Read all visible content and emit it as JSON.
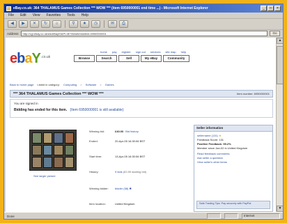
{
  "window": {
    "title": "eBay.co.uk: 364 THALAMUS Games Collection *** WOW *** (item 6950000001 end time ...) - Microsoft Internet Explorer",
    "controls": [
      "_",
      "□",
      "×"
    ]
  },
  "menu": [
    "File",
    "Edit",
    "View",
    "Favorites",
    "Tools",
    "Help"
  ],
  "toolbar": {
    "buttons": [
      {
        "name": "back",
        "glyph": "◀"
      },
      {
        "name": "forward",
        "glyph": "▶"
      },
      {
        "name": "stop",
        "glyph": "✕"
      },
      {
        "name": "refresh",
        "glyph": "↻"
      },
      {
        "name": "home",
        "glyph": "⌂"
      },
      {
        "name": "search",
        "glyph": "⚲"
      },
      {
        "name": "favorites",
        "glyph": "★"
      },
      {
        "name": "history",
        "glyph": "◷"
      },
      {
        "name": "mail",
        "glyph": "✉"
      },
      {
        "name": "print",
        "glyph": "⎙"
      }
    ]
  },
  "address": {
    "label": "Address",
    "url": "http://cgi.ebay.co.uk/ws/eBayISAPI.dll?ViewItem&item=6950000001",
    "go_label": "Go"
  },
  "page": {
    "logo": {
      "e": "e",
      "b": "b",
      "a": "a",
      "y": "Y",
      "suffix": ".co.uk"
    },
    "top_links": [
      "home",
      "pay",
      "register",
      "sign out",
      "services",
      "site map",
      "help"
    ],
    "nav_tabs": [
      "Browse",
      "Search",
      "Sell",
      "My eBay",
      "Community"
    ],
    "breadcrumbs": [
      "Back to home page",
      "Listed in category:",
      "Computing",
      "Software",
      "Games"
    ],
    "item_title": "*** 364 THALAMUS Games Collection *** WOW ***",
    "item_number": "Item number: 6950000001",
    "end_notice": {
      "line1": "You are signed in",
      "line2": "Bidding has ended for this item.",
      "link": "(Item 6950000001 is still available)"
    },
    "photo_caption": "See larger picture",
    "specs": [
      {
        "label": "Winning bid:",
        "value": "£40.00",
        "link": "Bid history"
      },
      {
        "label": "Ended:",
        "value": "20-Apr-05 16:30:06 BST",
        "link": ""
      },
      {
        "label": "Start time:",
        "value": "13-Apr-05 16:30:06 BST",
        "link": ""
      },
      {
        "label": "History:",
        "value": "9 bids",
        "link": "(£0.99 starting bid)"
      },
      {
        "label": "Winning bidder:",
        "value": "",
        "link": "bidder (58)"
      },
      {
        "label": "Item location:",
        "value": "United Kingdom",
        "link": ""
      }
    ],
    "seller": {
      "heading": "Seller information",
      "name": "sellername (131)",
      "lines": [
        "Feedback Score: 131",
        "Positive Feedback: 99.2%",
        "Member since Jan-02 in United Kingdom"
      ],
      "links": [
        "Read feedback comments",
        "Ask seller a question",
        "View seller's other items"
      ],
      "bottom": "Safe Trading Tips: Pay securely with PayPal"
    }
  },
  "status": {
    "text": "Done",
    "zone": "Internet"
  }
}
